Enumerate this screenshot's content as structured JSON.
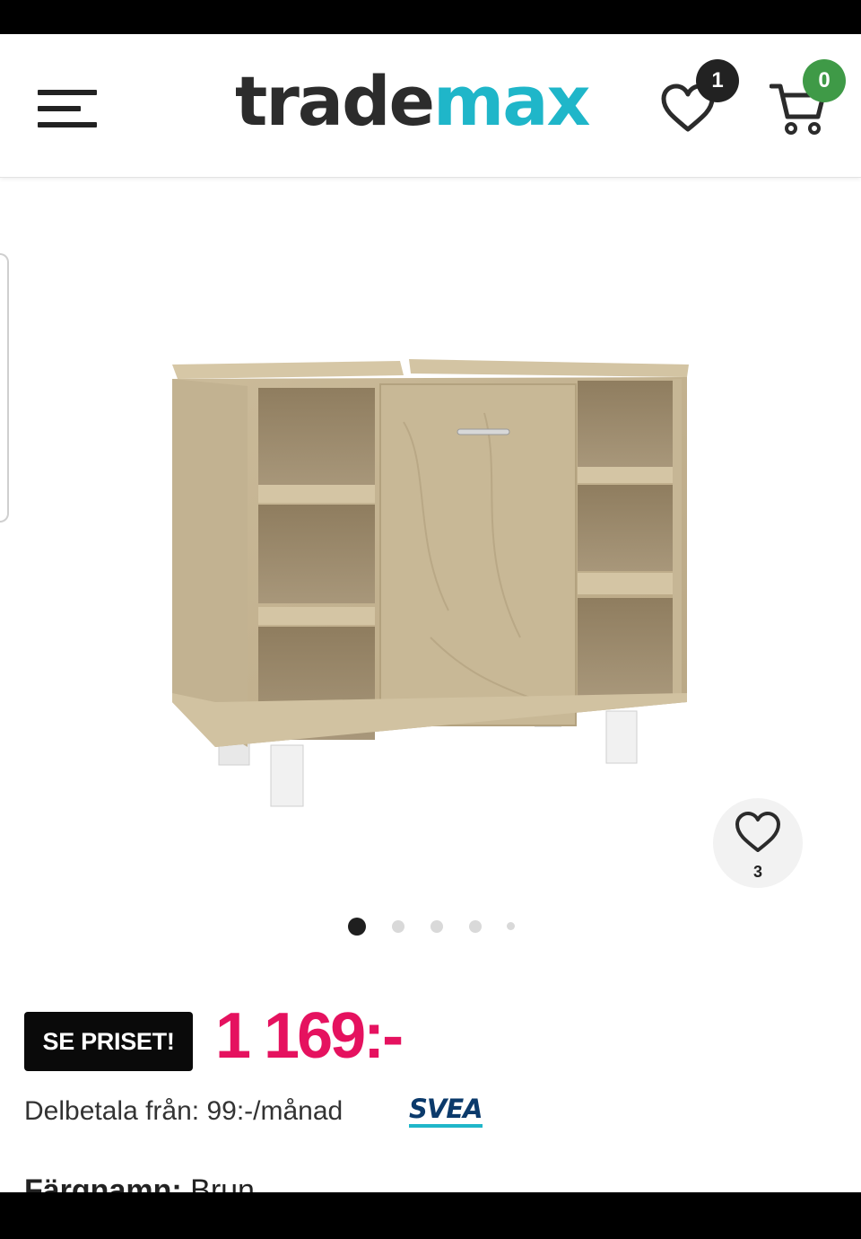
{
  "header": {
    "logo_part1": "trade",
    "logo_part2": "max",
    "wishlist_count": "1",
    "cart_count": "0",
    "brand_colors": {
      "dark": "#2c2c2c",
      "accent": "#1fb6c9",
      "cart_badge": "#3f9a47"
    }
  },
  "product": {
    "image_icon": "bathroom-cabinet-image",
    "favorites_count": "3",
    "carousel": {
      "total_slides": 5,
      "active_slide": 1
    },
    "price_badge": "SE PRISET!",
    "price": "1 169:-",
    "price_color": "#e5125f",
    "installment_text": "Delbetala från: 99:-/månad",
    "installment_provider": "SVEA",
    "color_label": "Färgnamn:",
    "color_value": "Brun"
  }
}
